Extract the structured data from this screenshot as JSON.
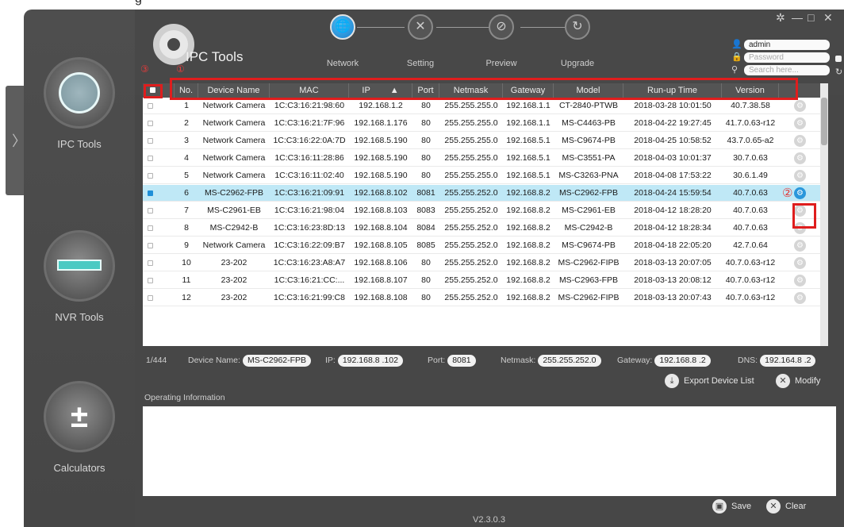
{
  "app": {
    "title": "IPC Tools",
    "version": "V2.3.0.3"
  },
  "sidebar": {
    "items": [
      {
        "label": "IPC Tools"
      },
      {
        "label": "NVR Tools"
      },
      {
        "label": "Calculators"
      }
    ]
  },
  "steps": [
    {
      "label": "Network",
      "icon": "globe-icon",
      "glyph": "🌐"
    },
    {
      "label": "Setting",
      "icon": "tools-icon",
      "glyph": "✕"
    },
    {
      "label": "Preview",
      "icon": "preview-icon",
      "glyph": "⊘"
    },
    {
      "label": "Upgrade",
      "icon": "upgrade-icon",
      "glyph": "↻"
    }
  ],
  "window_controls": {
    "settings": "✲",
    "minimize": "—",
    "maximize": "□",
    "close": "✕"
  },
  "login": {
    "username": "admin",
    "password_placeholder": "Password",
    "search_placeholder": "Search here..."
  },
  "markers": {
    "one": "①",
    "two": "②",
    "three": "③"
  },
  "table": {
    "columns": [
      "No.",
      "Device Name",
      "MAC",
      "IP",
      "Port",
      "Netmask",
      "Gateway",
      "Model",
      "Run-up Time",
      "Version"
    ],
    "sort_indicator": "▲",
    "rows": [
      {
        "no": "1",
        "name": "Network Camera",
        "mac": "1C:C3:16:21:98:60",
        "ip": "192.168.1.2",
        "port": "80",
        "netmask": "255.255.255.0",
        "gateway": "192.168.1.1",
        "model": "CT-2840-PTWB",
        "runup": "2018-03-28 10:01:50",
        "version": "40.7.38.58",
        "selected": false
      },
      {
        "no": "2",
        "name": "Network Camera",
        "mac": "1C:C3:16:21:7F:96",
        "ip": "192.168.1.176",
        "port": "80",
        "netmask": "255.255.255.0",
        "gateway": "192.168.1.1",
        "model": "MS-C4463-PB",
        "runup": "2018-04-22 19:27:45",
        "version": "41.7.0.63-r12",
        "selected": false
      },
      {
        "no": "3",
        "name": "Network Camera",
        "mac": "1C:C3:16:22:0A:7D",
        "ip": "192.168.5.190",
        "port": "80",
        "netmask": "255.255.255.0",
        "gateway": "192.168.5.1",
        "model": "MS-C9674-PB",
        "runup": "2018-04-25 10:58:52",
        "version": "43.7.0.65-a2",
        "selected": false
      },
      {
        "no": "4",
        "name": "Network Camera",
        "mac": "1C:C3:16:11:28:86",
        "ip": "192.168.5.190",
        "port": "80",
        "netmask": "255.255.255.0",
        "gateway": "192.168.5.1",
        "model": "MS-C3551-PA",
        "runup": "2018-04-03 10:01:37",
        "version": "30.7.0.63",
        "selected": false
      },
      {
        "no": "5",
        "name": "Network Camera",
        "mac": "1C:C3:16:11:02:40",
        "ip": "192.168.5.190",
        "port": "80",
        "netmask": "255.255.255.0",
        "gateway": "192.168.5.1",
        "model": "MS-C3263-PNA",
        "runup": "2018-04-08 17:53:22",
        "version": "30.6.1.49",
        "selected": false
      },
      {
        "no": "6",
        "name": "MS-C2962-FPB",
        "mac": "1C:C3:16:21:09:91",
        "ip": "192.168.8.102",
        "port": "8081",
        "netmask": "255.255.252.0",
        "gateway": "192.168.8.2",
        "model": "MS-C2962-FPB",
        "runup": "2018-04-24 15:59:54",
        "version": "40.7.0.63",
        "selected": true
      },
      {
        "no": "7",
        "name": "MS-C2961-EB",
        "mac": "1C:C3:16:21:98:04",
        "ip": "192.168.8.103",
        "port": "8083",
        "netmask": "255.255.252.0",
        "gateway": "192.168.8.2",
        "model": "MS-C2961-EB",
        "runup": "2018-04-12 18:28:20",
        "version": "40.7.0.63",
        "selected": false
      },
      {
        "no": "8",
        "name": "MS-C2942-B",
        "mac": "1C:C3:16:23:8D:13",
        "ip": "192.168.8.104",
        "port": "8084",
        "netmask": "255.255.252.0",
        "gateway": "192.168.8.2",
        "model": "MS-C2942-B",
        "runup": "2018-04-12 18:28:34",
        "version": "40.7.0.63",
        "selected": false
      },
      {
        "no": "9",
        "name": "Network Camera",
        "mac": "1C:C3:16:22:09:B7",
        "ip": "192.168.8.105",
        "port": "8085",
        "netmask": "255.255.252.0",
        "gateway": "192.168.8.2",
        "model": "MS-C9674-PB",
        "runup": "2018-04-18 22:05:20",
        "version": "42.7.0.64",
        "selected": false
      },
      {
        "no": "10",
        "name": "23-202",
        "mac": "1C:C3:16:23:A8:A7",
        "ip": "192.168.8.106",
        "port": "80",
        "netmask": "255.255.252.0",
        "gateway": "192.168.8.2",
        "model": "MS-C2962-FIPB",
        "runup": "2018-03-13 20:07:05",
        "version": "40.7.0.63-r12",
        "selected": false
      },
      {
        "no": "11",
        "name": "23-202",
        "mac": "1C:C3:16:21:CC:...",
        "ip": "192.168.8.107",
        "port": "80",
        "netmask": "255.255.252.0",
        "gateway": "192.168.8.2",
        "model": "MS-C2963-FPB",
        "runup": "2018-03-13 20:08:12",
        "version": "40.7.0.63-r12",
        "selected": false
      },
      {
        "no": "12",
        "name": "23-202",
        "mac": "1C:C3:16:21:99:C8",
        "ip": "192.168.8.108",
        "port": "80",
        "netmask": "255.255.252.0",
        "gateway": "192.168.8.2",
        "model": "MS-C2962-FIPB",
        "runup": "2018-03-13 20:07:43",
        "version": "40.7.0.63-r12",
        "selected": false
      }
    ]
  },
  "detail": {
    "count": "1/444",
    "device_name_label": "Device Name:",
    "device_name": "MS-C2962-FPB",
    "ip_label": "IP:",
    "ip": "192.168.8 .102",
    "port_label": "Port:",
    "port": "8081",
    "netmask_label": "Netmask:",
    "netmask": "255.255.252.0",
    "gateway_label": "Gateway:",
    "gateway": "192.168.8 .2",
    "dns_label": "DNS:",
    "dns": "192.164.8 .2"
  },
  "actions": {
    "export": "Export Device List",
    "modify": "Modify",
    "save": "Save",
    "clear": "Clear"
  },
  "operating_info_label": "Operating Information",
  "colors": {
    "accent": "#2a97db",
    "highlight": "#df1d1d",
    "selected_row": "#bfe8f6"
  }
}
